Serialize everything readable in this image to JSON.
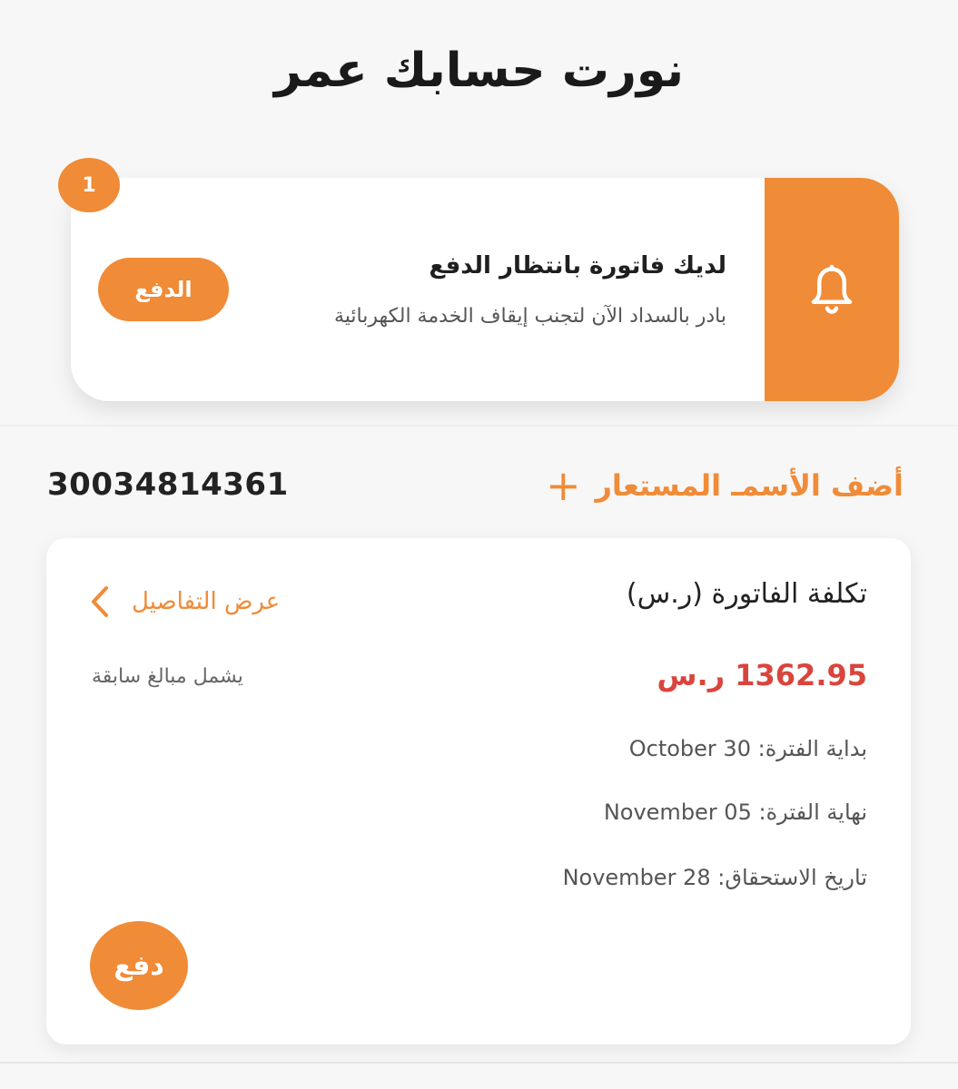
{
  "header": {
    "greeting": "نورت حسابك عمر"
  },
  "notification": {
    "badge_count": "1",
    "title": "لديك فاتورة بانتظار الدفع",
    "subtitle": "بادر بالسداد الآن لتجنب إيقاف الخدمة الكهربائية",
    "pay_label": "الدفع",
    "icon": "bell-icon"
  },
  "account": {
    "add_alias_label": "أضف الأسمـ المستعار",
    "add_icon": "plus-icon",
    "number": "30034814361"
  },
  "bill": {
    "title": "تكلفة الفاتورة (ر.س)",
    "view_details_label": "عرض التفاصيل",
    "amount": "1362.95 ر.س",
    "includes_note": "يشمل مبالغ سابقة",
    "period_start_label": "بداية الفترة:",
    "period_start": "October 30",
    "period_end_label": "نهاية الفترة:",
    "period_end": "November 05",
    "due_date_label": "تاريخ الاستحقاق:",
    "due_date": "November 28",
    "pay_label": "دفع"
  },
  "colors": {
    "accent": "#f08b37",
    "amount": "#d9453d",
    "background": "#f7f7f7"
  }
}
